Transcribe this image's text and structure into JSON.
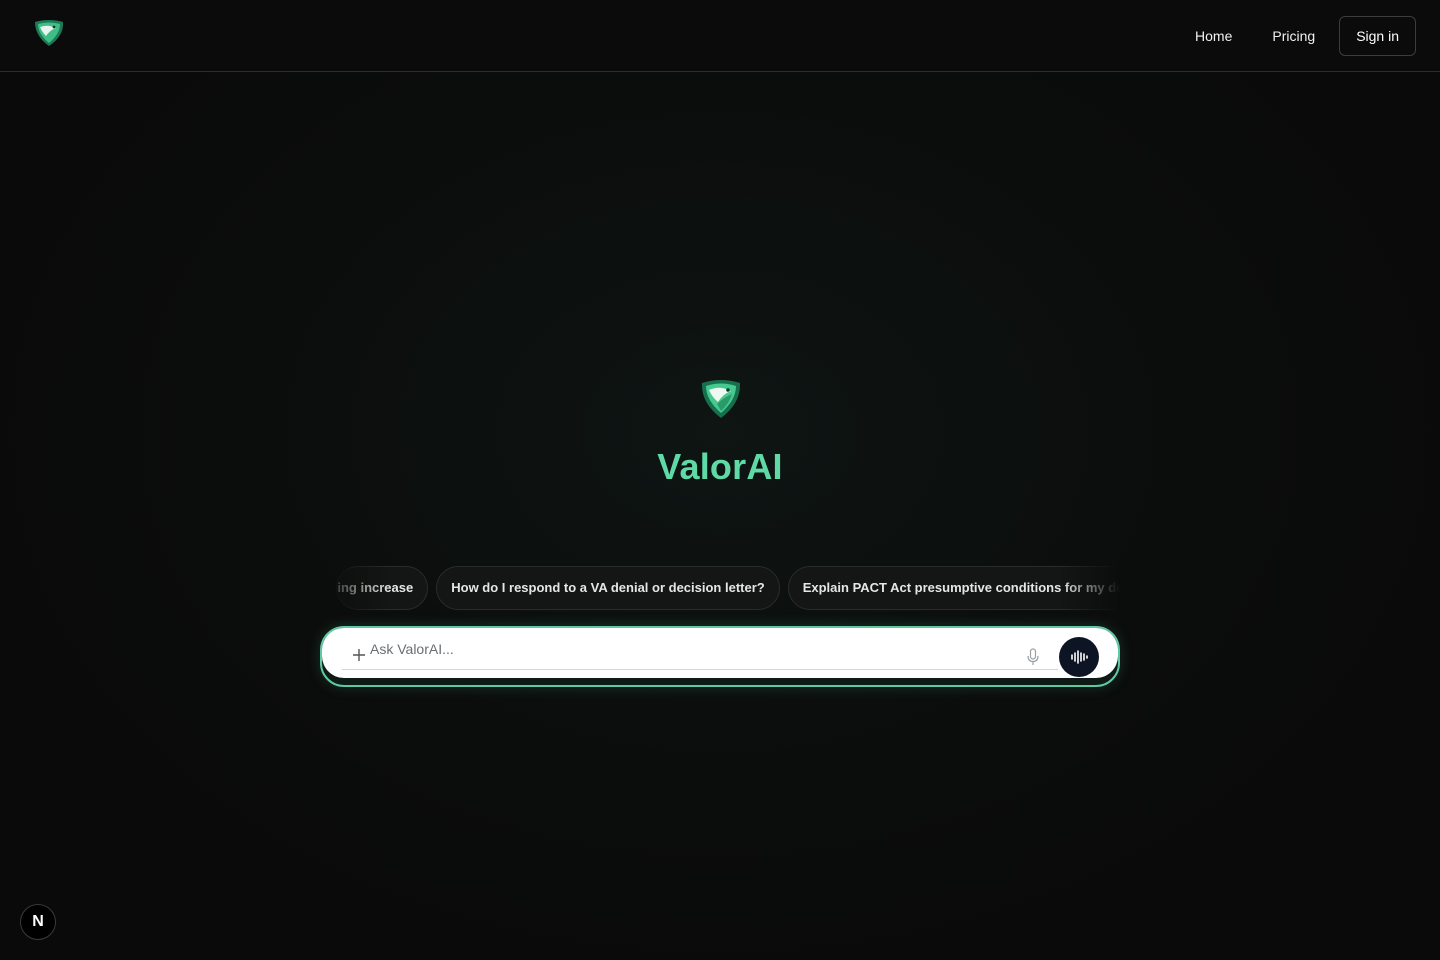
{
  "nav": {
    "home": "Home",
    "pricing": "Pricing",
    "sign_in": "Sign in"
  },
  "brand": {
    "name": "ValorAI",
    "logo_icon": "eagle-shield-icon",
    "accent_color": "#5fd9a6"
  },
  "suggestions": [
    "ing increase.",
    "How do I respond to a VA denial or decision letter?",
    "Explain PACT Act presumptive conditions for my depl"
  ],
  "composer": {
    "placeholder": "Ask ValorAI...",
    "attach_icon": "plus-icon",
    "mic_icon": "microphone-icon",
    "voice_icon": "voice-waveform-icon"
  },
  "dev_badge": {
    "label": "N"
  }
}
